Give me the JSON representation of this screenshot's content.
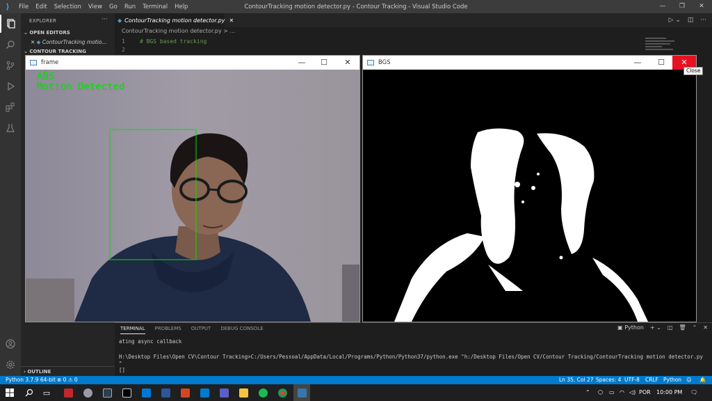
{
  "window": {
    "title": "ContourTracking motion detector.py - Contour Tracking - Visual Studio Code",
    "menu": [
      "File",
      "Edit",
      "Selection",
      "View",
      "Go",
      "Run",
      "Terminal",
      "Help"
    ]
  },
  "sidebar": {
    "header": "EXPLORER",
    "open_editors": "OPEN EDITORS",
    "open_file": "ContourTracking motio...",
    "folder": "CONTOUR TRACKING",
    "outline": "OUTLINE"
  },
  "editor": {
    "tab_label": "ContourTracking motion detector.py",
    "breadcrumb": "ContourTracking motion detector.py > ...",
    "lines": [
      {
        "num": "1",
        "text": "# BGS based tracking"
      },
      {
        "num": "2",
        "text": ""
      }
    ]
  },
  "frame_window": {
    "title": "frame",
    "overlay_line1": "ABS",
    "overlay_line2": "Motion Detected"
  },
  "bgs_window": {
    "title": "BGS",
    "close_tooltip": "Close"
  },
  "panel": {
    "tabs": [
      "TERMINAL",
      "PROBLEMS",
      "OUTPUT",
      "DEBUG CONSOLE"
    ],
    "shell": "Python",
    "lines": [
      "ating async callback",
      "H:\\Desktop Files\\Open CV\\Contour Tracking>C:/Users/Pessoal/AppData/Local/Programs/Python/Python37/python.exe \"h:/Desktop Files/Open CV/Contour Tracking/ContourTracking motion detector.py",
      "\"",
      "[]"
    ]
  },
  "statusbar": {
    "interpreter": "Python 3.7.9 64-bit",
    "problems": "⊗ 0 ⚠ 0",
    "position": "Ln 35, Col 27",
    "spaces": "Spaces: 4",
    "encoding": "UTF-8",
    "eol": "CRLF",
    "language": "Python"
  },
  "taskbar": {
    "lang": "POR",
    "time": "10:00 PM"
  },
  "colors": {
    "accent": "#007acc",
    "overlay_text": "#00e000",
    "close_hover": "#e81123"
  }
}
